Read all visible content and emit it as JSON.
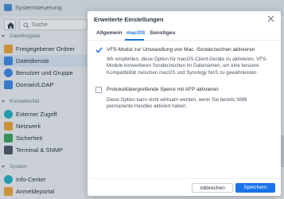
{
  "window": {
    "title": "Systemsteuerung"
  },
  "sidebar": {
    "search_placeholder": "Suche",
    "sections": [
      {
        "label": "Dateifreigabe",
        "items": [
          {
            "label": "Freigegebener Ordner",
            "icon": "shared-folder-icon",
            "color": "#f0a73a"
          },
          {
            "label": "Dateidienste",
            "icon": "file-services-icon",
            "color": "#3c8be6",
            "active": true
          },
          {
            "label": "Benutzer und Gruppe",
            "icon": "user-group-icon",
            "color": "#3c8be6"
          },
          {
            "label": "Domain/LDAP",
            "icon": "domain-icon",
            "color": "#3c8be6"
          }
        ]
      },
      {
        "label": "Konnektivität",
        "items": [
          {
            "label": "Externer Zugriff",
            "icon": "external-access-icon",
            "color": "#23b2c5"
          },
          {
            "label": "Netzwerk",
            "icon": "network-icon",
            "color": "#f0a73a"
          },
          {
            "label": "Sicherheit",
            "icon": "security-icon",
            "color": "#3ba55c"
          },
          {
            "label": "Terminal & SNMP",
            "icon": "terminal-icon",
            "color": "#4b5867"
          }
        ]
      },
      {
        "label": "System",
        "items": [
          {
            "label": "Info-Center",
            "icon": "info-center-icon",
            "color": "#23b2c5"
          },
          {
            "label": "Anmeldeportal",
            "icon": "login-portal-icon",
            "color": "#f0a73a"
          }
        ]
      }
    ]
  },
  "dialog": {
    "title": "Erweiterte Einstellungen",
    "tabs": [
      "Allgemein",
      "macOS",
      "Sonstiges"
    ],
    "active_tab": "macOS",
    "option1_label": "VFS-Modul zur Umwandlung von Mac -Sonderzeichen aktivieren",
    "option1_checked": true,
    "option1_desc": "Wir empfehlen, diese Option für macOS-Client-Geräte zu aktivieren. VFS-Module konvertieren Sonderzeichen im Dateinamen, um eine bessere Kompatibilität zwischen macOS und Synology NAS zu gewährleisten.",
    "option2_label": "Protokollübergreifende Sperre mit AFP aktivieren",
    "option2_checked": false,
    "option2_desc": "Diese Option kann nicht wirksam werden, wenn Sie bereits SMB permanente Handles aktiviert haben.",
    "cancel_label": "Abbrechen",
    "save_label": "Speichern"
  },
  "colors": {
    "accent": "#1a73e8",
    "active_item_bg": "#dbe7f4"
  }
}
